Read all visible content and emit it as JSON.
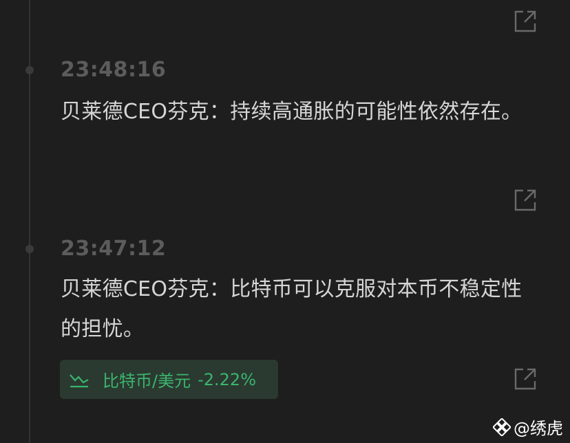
{
  "feed": {
    "items": [
      {
        "time": "23:48:16",
        "text": "贝莱德CEO芬克：持续高通胀的可能性依然存在。"
      },
      {
        "time": "23:47:12",
        "text": "贝莱德CEO芬克：比特币可以克服对本币不稳定性的担忧。",
        "ticker": {
          "label": "比特币/美元",
          "change": "-2.22%",
          "color": "#3cb46e",
          "icon": "trend-down-icon"
        }
      }
    ]
  },
  "watermark": {
    "text": "@绣虎",
    "icon": "binance-logo-icon"
  },
  "icons": {
    "share": "share-external-icon"
  },
  "colors": {
    "background": "#1e1e1e",
    "time": "#5c5c5c",
    "text": "#d6d6d6",
    "ticker_bg": "#2a3a30",
    "ticker_fg": "#3cb46e"
  }
}
